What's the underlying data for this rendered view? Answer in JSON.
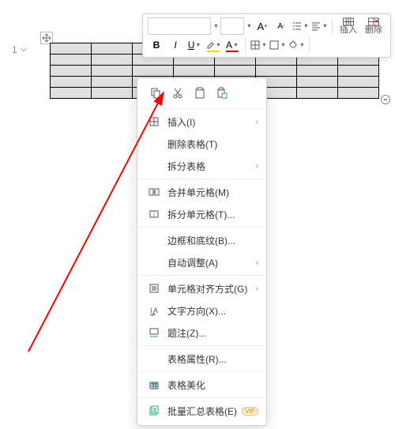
{
  "page_indicator": "1",
  "toolbar": {
    "font_name": "",
    "font_size": "",
    "bold": "B",
    "italic": "I",
    "underline": "U",
    "highlight": "A",
    "font_color": "A",
    "increase_font": "A⁺",
    "decrease_font": "A⁻",
    "insert_label": "插入",
    "delete_label": "删除"
  },
  "ctx_top": {
    "copy": "copy",
    "cut": "cut",
    "paste": "paste",
    "paste_special": "paste-special"
  },
  "menu": {
    "insert": "插入(I)",
    "delete_table": "删除表格(T)",
    "split_table": "拆分表格",
    "merge_cells": "合并单元格(M)",
    "split_cells": "拆分单元格(T)...",
    "borders_shading": "边框和底纹(B)...",
    "auto_fit": "自动调整(A)",
    "cell_alignment": "单元格对齐方式(G)",
    "text_direction": "文字方向(X)...",
    "caption": "题注(Z)...",
    "table_properties": "表格属性(R)...",
    "table_beautify": "表格美化",
    "batch_summary": "批量汇总表格(E)",
    "vip": "VIP"
  }
}
